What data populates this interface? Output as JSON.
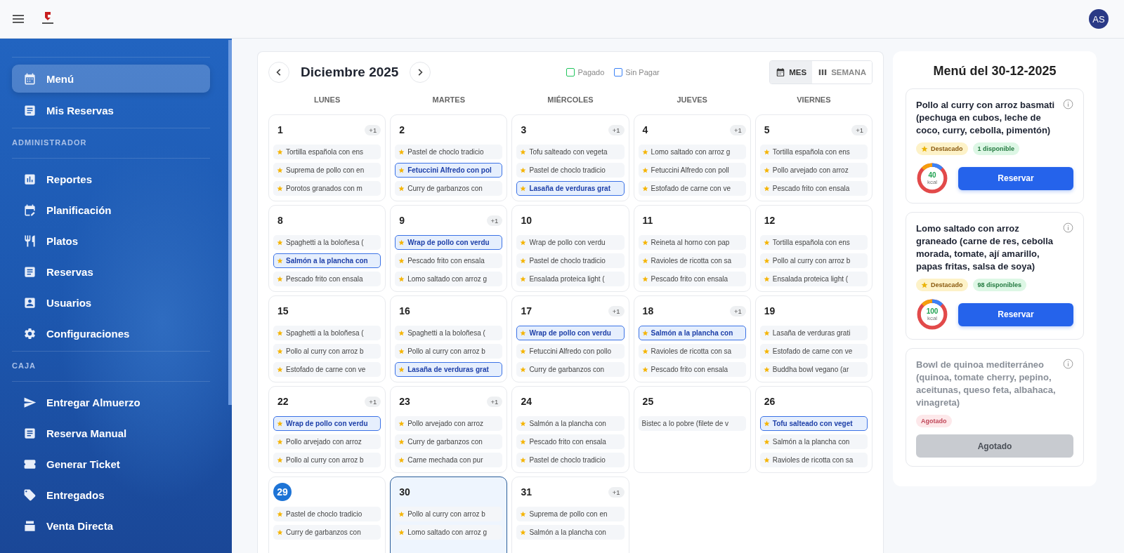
{
  "header": {
    "avatar": "AS"
  },
  "sidebar": {
    "groups": [
      {
        "items": [
          {
            "label": "Menú",
            "selected": true
          },
          {
            "label": "Mis Reservas",
            "selected": false
          }
        ]
      },
      {
        "title": "ADMINISTRADOR",
        "items": [
          {
            "label": "Reportes",
            "selected": false
          },
          {
            "label": "Planificación",
            "selected": false
          },
          {
            "label": "Platos",
            "selected": false
          },
          {
            "label": "Reservas",
            "selected": false
          },
          {
            "label": "Usuarios",
            "selected": false
          },
          {
            "label": "Configuraciones",
            "selected": false
          }
        ]
      },
      {
        "title": "CAJA",
        "items": [
          {
            "label": "Entregar Almuerzo",
            "selected": false
          },
          {
            "label": "Reserva Manual",
            "selected": false
          },
          {
            "label": "Generar Ticket",
            "selected": false
          },
          {
            "label": "Entregados",
            "selected": false
          },
          {
            "label": "Venta Directa",
            "selected": false
          }
        ]
      }
    ]
  },
  "calendar": {
    "title": "Diciembre 2025",
    "legend": [
      {
        "label": "Pagado",
        "color": "#22c55e"
      },
      {
        "label": "Sin Pagar",
        "color": "#3b82f6"
      }
    ],
    "views": [
      {
        "label": "MES",
        "selected": true
      },
      {
        "label": "SEMANA",
        "selected": false
      }
    ],
    "weekdays": [
      "LUNES",
      "MARTES",
      "MIÉRCOLES",
      "JUEVES",
      "VIERNES"
    ],
    "weeks": [
      [
        {
          "day": "1",
          "more": "+1",
          "today": false,
          "selected": false,
          "meals": [
            {
              "name": "Tortilla española con ens",
              "featured": true,
              "reserved": false
            },
            {
              "name": "Suprema de pollo con en",
              "featured": true,
              "reserved": false
            },
            {
              "name": "Porotos granados con m",
              "featured": true,
              "reserved": false
            }
          ]
        },
        {
          "day": "2",
          "today": false,
          "selected": false,
          "meals": [
            {
              "name": "Pastel de choclo tradicio",
              "featured": true,
              "reserved": false
            },
            {
              "name": "Fetuccini Alfredo con pol",
              "featured": true,
              "reserved": true
            },
            {
              "name": "Curry de garbanzos con",
              "featured": true,
              "reserved": false
            }
          ]
        },
        {
          "day": "3",
          "more": "+1",
          "today": false,
          "selected": false,
          "meals": [
            {
              "name": "Tofu salteado con vegeta",
              "featured": true,
              "reserved": false
            },
            {
              "name": "Pastel de choclo tradicio",
              "featured": true,
              "reserved": false
            },
            {
              "name": "Lasaña de verduras grat",
              "featured": true,
              "reserved": true
            }
          ]
        },
        {
          "day": "4",
          "more": "+1",
          "today": false,
          "selected": false,
          "meals": [
            {
              "name": "Lomo saltado con arroz g",
              "featured": true,
              "reserved": false
            },
            {
              "name": "Fetuccini Alfredo con poll",
              "featured": true,
              "reserved": false
            },
            {
              "name": "Estofado de carne con ve",
              "featured": true,
              "reserved": false
            }
          ]
        },
        {
          "day": "5",
          "more": "+1",
          "today": false,
          "selected": false,
          "meals": [
            {
              "name": "Tortilla española con ens",
              "featured": true,
              "reserved": false
            },
            {
              "name": "Pollo arvejado con arroz",
              "featured": true,
              "reserved": false
            },
            {
              "name": "Pescado frito con ensala",
              "featured": true,
              "reserved": false
            }
          ]
        }
      ],
      [
        {
          "day": "8",
          "today": false,
          "selected": false,
          "meals": [
            {
              "name": "Spaghetti a la boloñesa (",
              "featured": true,
              "reserved": false
            },
            {
              "name": "Salmón a la plancha con",
              "featured": true,
              "reserved": true
            },
            {
              "name": "Pescado frito con ensala",
              "featured": true,
              "reserved": false
            }
          ]
        },
        {
          "day": "9",
          "more": "+1",
          "today": false,
          "selected": false,
          "meals": [
            {
              "name": "Wrap de pollo con verdu",
              "featured": true,
              "reserved": true
            },
            {
              "name": "Pescado frito con ensala",
              "featured": true,
              "reserved": false
            },
            {
              "name": "Lomo saltado con arroz g",
              "featured": true,
              "reserved": false
            }
          ]
        },
        {
          "day": "10",
          "today": false,
          "selected": false,
          "meals": [
            {
              "name": "Wrap de pollo con verdu",
              "featured": true,
              "reserved": false
            },
            {
              "name": "Pastel de choclo tradicio",
              "featured": true,
              "reserved": false
            },
            {
              "name": "Ensalada proteica light (",
              "featured": true,
              "reserved": false
            }
          ]
        },
        {
          "day": "11",
          "today": false,
          "selected": false,
          "meals": [
            {
              "name": "Reineta al horno con pap",
              "featured": true,
              "reserved": false
            },
            {
              "name": "Ravioles de ricotta con sa",
              "featured": true,
              "reserved": false
            },
            {
              "name": "Pescado frito con ensala",
              "featured": true,
              "reserved": false
            }
          ]
        },
        {
          "day": "12",
          "today": false,
          "selected": false,
          "meals": [
            {
              "name": "Tortilla española con ens",
              "featured": true,
              "reserved": false
            },
            {
              "name": "Pollo al curry con arroz b",
              "featured": true,
              "reserved": false
            },
            {
              "name": "Ensalada proteica light (",
              "featured": true,
              "reserved": false
            }
          ]
        }
      ],
      [
        {
          "day": "15",
          "today": false,
          "selected": false,
          "meals": [
            {
              "name": "Spaghetti a la boloñesa (",
              "featured": true,
              "reserved": false
            },
            {
              "name": "Pollo al curry con arroz b",
              "featured": true,
              "reserved": false
            },
            {
              "name": "Estofado de carne con ve",
              "featured": true,
              "reserved": false
            }
          ]
        },
        {
          "day": "16",
          "today": false,
          "selected": false,
          "meals": [
            {
              "name": "Spaghetti a la boloñesa (",
              "featured": true,
              "reserved": false
            },
            {
              "name": "Pollo al curry con arroz b",
              "featured": true,
              "reserved": false
            },
            {
              "name": "Lasaña de verduras grat",
              "featured": true,
              "reserved": true
            }
          ]
        },
        {
          "day": "17",
          "more": "+1",
          "today": false,
          "selected": false,
          "meals": [
            {
              "name": "Wrap de pollo con verdu",
              "featured": true,
              "reserved": true
            },
            {
              "name": "Fetuccini Alfredo con pollo",
              "featured": true,
              "reserved": false
            },
            {
              "name": "Curry de garbanzos con",
              "featured": true,
              "reserved": false
            }
          ]
        },
        {
          "day": "18",
          "more": "+1",
          "today": false,
          "selected": false,
          "meals": [
            {
              "name": "Salmón a la plancha con",
              "featured": true,
              "reserved": true
            },
            {
              "name": "Ravioles de ricotta con sa",
              "featured": true,
              "reserved": false
            },
            {
              "name": "Pescado frito con ensala",
              "featured": true,
              "reserved": false
            }
          ]
        },
        {
          "day": "19",
          "today": false,
          "selected": false,
          "meals": [
            {
              "name": "Lasaña de verduras grati",
              "featured": true,
              "reserved": false
            },
            {
              "name": "Estofado de carne con ve",
              "featured": true,
              "reserved": false
            },
            {
              "name": "Buddha bowl vegano (ar",
              "featured": true,
              "reserved": false
            }
          ]
        }
      ],
      [
        {
          "day": "22",
          "more": "+1",
          "today": false,
          "selected": false,
          "meals": [
            {
              "name": "Wrap de pollo con verdu",
              "featured": true,
              "reserved": true
            },
            {
              "name": "Pollo arvejado con arroz",
              "featured": true,
              "reserved": false
            },
            {
              "name": "Pollo al curry con arroz b",
              "featured": true,
              "reserved": false
            }
          ]
        },
        {
          "day": "23",
          "more": "+1",
          "today": false,
          "selected": false,
          "meals": [
            {
              "name": "Pollo arvejado con arroz",
              "featured": true,
              "reserved": false
            },
            {
              "name": "Curry de garbanzos con",
              "featured": true,
              "reserved": false
            },
            {
              "name": "Carne mechada con pur",
              "featured": true,
              "reserved": false
            }
          ]
        },
        {
          "day": "24",
          "today": false,
          "selected": false,
          "meals": [
            {
              "name": "Salmón a la plancha con",
              "featured": true,
              "reserved": false
            },
            {
              "name": "Pescado frito con ensala",
              "featured": true,
              "reserved": false
            },
            {
              "name": "Pastel de choclo tradicio",
              "featured": true,
              "reserved": false
            }
          ]
        },
        {
          "day": "25",
          "today": false,
          "selected": false,
          "meals": [
            {
              "name": "Bistec a lo pobre (filete de v",
              "featured": false,
              "reserved": false
            }
          ]
        },
        {
          "day": "26",
          "today": false,
          "selected": false,
          "meals": [
            {
              "name": "Tofu salteado con veget",
              "featured": true,
              "reserved": true
            },
            {
              "name": "Salmón a la plancha con",
              "featured": true,
              "reserved": false
            },
            {
              "name": "Ravioles de ricotta con sa",
              "featured": true,
              "reserved": false
            }
          ]
        }
      ],
      [
        {
          "day": "29",
          "today": true,
          "selected": false,
          "meals": [
            {
              "name": "Pastel de choclo tradicio",
              "featured": true,
              "reserved": false
            },
            {
              "name": "Curry de garbanzos con",
              "featured": true,
              "reserved": false
            }
          ]
        },
        {
          "day": "30",
          "today": false,
          "selected": true,
          "meals": [
            {
              "name": "Pollo al curry con arroz b",
              "featured": true,
              "reserved": false
            },
            {
              "name": "Lomo saltado con arroz g",
              "featured": true,
              "reserved": false
            }
          ]
        },
        {
          "day": "31",
          "more": "+1",
          "today": false,
          "selected": false,
          "meals": [
            {
              "name": "Suprema de pollo con en",
              "featured": true,
              "reserved": false
            },
            {
              "name": "Salmón a la plancha con",
              "featured": true,
              "reserved": false
            }
          ]
        }
      ]
    ]
  },
  "day_menu": {
    "title": "Menú del 30-12-2025",
    "dishes": [
      {
        "name": "Pollo al curry con arroz basmati (pechuga en cubos, leche de coco, curry, cebolla, pimentón)",
        "sold_out": false,
        "tags": [
          {
            "kind": "featured",
            "label": "Destacado"
          },
          {
            "kind": "stock",
            "label": "1 disponible"
          }
        ],
        "kcal": "40",
        "kcal_unit": "kcal",
        "button": "Reservar"
      },
      {
        "name": "Lomo saltado con arroz graneado (carne de res, cebolla morada, tomate, ají amarillo, papas fritas, salsa de soya)",
        "sold_out": false,
        "tags": [
          {
            "kind": "featured",
            "label": "Destacado"
          },
          {
            "kind": "stock",
            "label": "98 disponibles"
          }
        ],
        "kcal": "100",
        "kcal_unit": "kcal",
        "button": "Reservar"
      },
      {
        "name": "Bowl de quinoa mediterráneo (quinoa, tomate cherry, pepino, aceitunas, queso feta, albahaca, vinagreta)",
        "sold_out": true,
        "tags": [
          {
            "kind": "sold_out",
            "label": "Agotado"
          }
        ],
        "button": "Agotado"
      }
    ]
  }
}
